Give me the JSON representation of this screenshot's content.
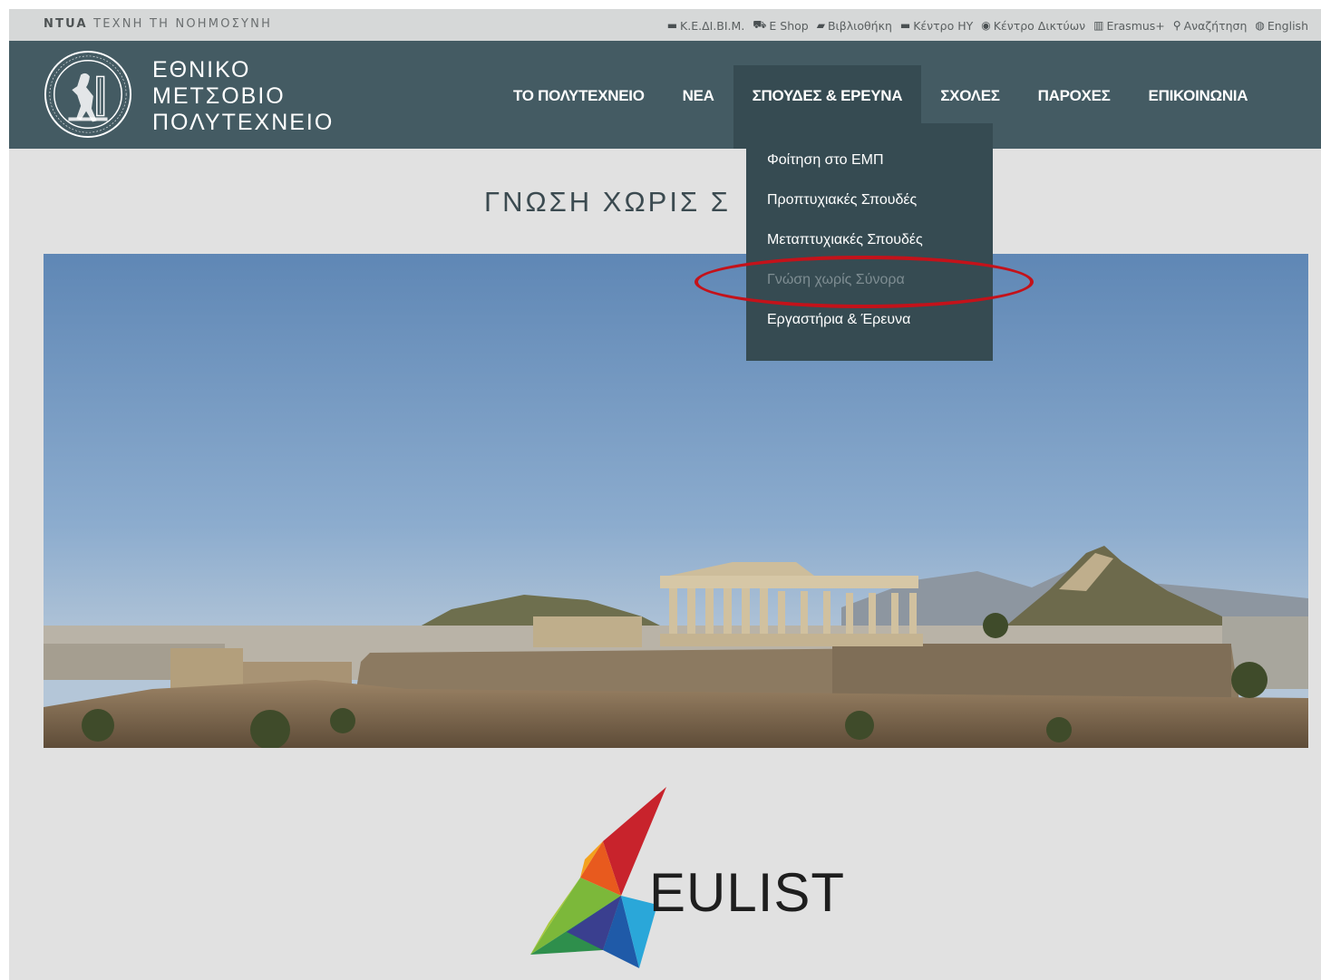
{
  "topbar": {
    "tagline_bold": "NTUA",
    "tagline_rest": " ΤΕΧΝΗ ΤΗ ΝΟΗΜΟΣΥΝΗ",
    "links": [
      {
        "label": "Κ.Ε.ΔΙ.ΒΙ.Μ.",
        "icon": "flag-icon",
        "glyph": "▬"
      },
      {
        "label": "E Shop",
        "icon": "cart-icon",
        "glyph": "⛟"
      },
      {
        "label": "Βιβλιοθήκη",
        "icon": "book-icon",
        "glyph": "▰"
      },
      {
        "label": "Κέντρο ΗΥ",
        "icon": "flag-icon",
        "glyph": "▬"
      },
      {
        "label": "Κέντρο Δικτύων",
        "icon": "network-icon",
        "glyph": "◉"
      },
      {
        "label": "Erasmus+",
        "icon": "institution-icon",
        "glyph": "▥"
      },
      {
        "label": "Αναζήτηση",
        "icon": "search-icon",
        "glyph": "⚲"
      },
      {
        "label": "English",
        "icon": "globe-icon",
        "glyph": "◍"
      }
    ]
  },
  "header": {
    "logo_lines": [
      "ΕΘΝΙΚΟ",
      "ΜΕΤΣΟΒΙΟ",
      "ΠΟΛΥΤΕΧΝΕΙΟ"
    ],
    "nav": [
      {
        "label": "ΤΟ ΠΟΛΥΤΕΧΝΕΙΟ",
        "active": false
      },
      {
        "label": "ΝΕΑ",
        "active": false
      },
      {
        "label": "ΣΠΟΥΔΕΣ & ΕΡΕΥΝΑ",
        "active": true
      },
      {
        "label": "ΣΧΟΛΕΣ",
        "active": false
      },
      {
        "label": "ΠΑΡΟΧΕΣ",
        "active": false
      },
      {
        "label": "ΕΠΙΚΟΙΝΩΝΙΑ",
        "active": false
      }
    ]
  },
  "dropdown": {
    "items": [
      {
        "label": "Φοίτηση στο ΕΜΠ",
        "muted": false
      },
      {
        "label": "Προπτυχιακές Σπουδές",
        "muted": false
      },
      {
        "label": "Μεταπτυχιακές Σπουδές",
        "muted": false
      },
      {
        "label": "Γνώση χωρίς Σύνορα",
        "muted": true
      },
      {
        "label": "Εργαστήρια & Έρευνα",
        "muted": false
      }
    ]
  },
  "main": {
    "section_title": "ΓΝΩΣΗ ΧΩΡΙΣ Σ",
    "eulist_label": "EULIST"
  },
  "colors": {
    "header_bg": "#445b63",
    "active_bg": "#364b52",
    "highlight": "#c4121a",
    "page_bg": "#e1e1e1"
  }
}
